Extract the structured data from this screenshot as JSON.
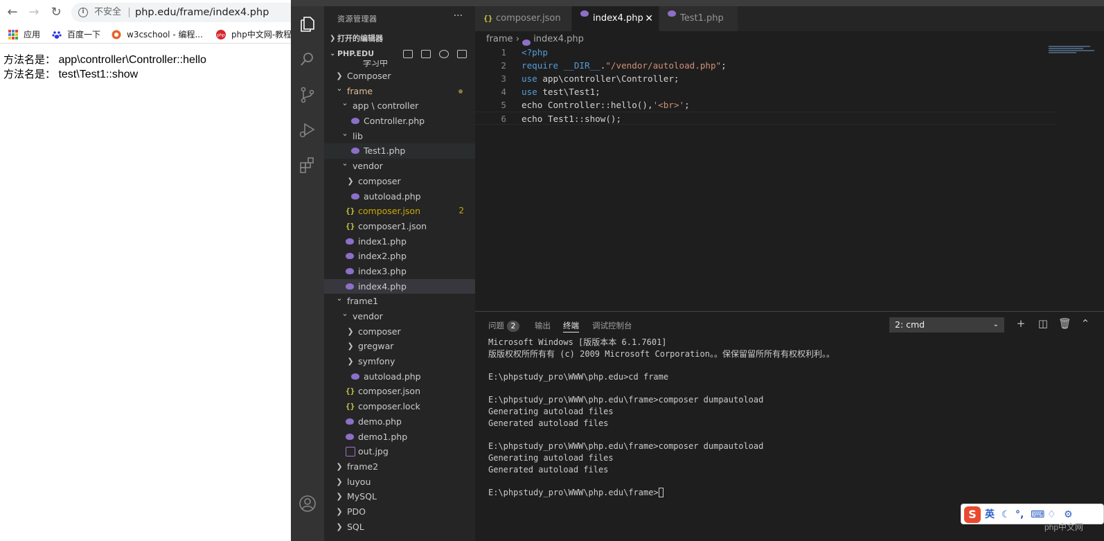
{
  "browser": {
    "url_warning": "不安全",
    "url": "php.edu/frame/index4.php",
    "bookmarks": [
      {
        "label": "应用",
        "icon": "apps-icon"
      },
      {
        "label": "百度一下",
        "icon": "baidu-paw-icon"
      },
      {
        "label": "w3cschool - 编程...",
        "icon": "w3cschool-icon"
      },
      {
        "label": "php中文网-教程",
        "icon": "php-cn-icon"
      }
    ],
    "output": [
      {
        "label": "方法名是：",
        "value": " app\\controller\\Controller::hello"
      },
      {
        "label": "方法名是：",
        "value": " test\\Test1::show"
      }
    ]
  },
  "explorer": {
    "title": "资源管理器",
    "open_editors_label": "打开的编辑器",
    "workspace_label": "PHP.EDU",
    "partial_top_label": "学习中",
    "items": [
      {
        "name": "Composer",
        "type": "folder",
        "depth": 0,
        "expanded": false
      },
      {
        "name": "frame",
        "type": "folder",
        "depth": 0,
        "expanded": true,
        "modified": true
      },
      {
        "name": "app \\ controller",
        "type": "folder",
        "depth": 1,
        "expanded": true
      },
      {
        "name": "Controller.php",
        "type": "php",
        "depth": 2
      },
      {
        "name": "lib",
        "type": "folder",
        "depth": 1,
        "expanded": true
      },
      {
        "name": "Test1.php",
        "type": "php",
        "depth": 2,
        "hover": true
      },
      {
        "name": "vendor",
        "type": "folder",
        "depth": 1,
        "expanded": true
      },
      {
        "name": "composer",
        "type": "folder",
        "depth": 2,
        "expanded": false
      },
      {
        "name": "autoload.php",
        "type": "php",
        "depth": 2
      },
      {
        "name": "composer.json",
        "type": "json",
        "depth": 1,
        "warning": true,
        "badge": "2"
      },
      {
        "name": "composer1.json",
        "type": "json",
        "depth": 1
      },
      {
        "name": "index1.php",
        "type": "php",
        "depth": 1
      },
      {
        "name": "index2.php",
        "type": "php",
        "depth": 1
      },
      {
        "name": "index3.php",
        "type": "php",
        "depth": 1
      },
      {
        "name": "index4.php",
        "type": "php",
        "depth": 1,
        "selected": true
      },
      {
        "name": "frame1",
        "type": "folder",
        "depth": 0,
        "expanded": true
      },
      {
        "name": "vendor",
        "type": "folder",
        "depth": 1,
        "expanded": true
      },
      {
        "name": "composer",
        "type": "folder",
        "depth": 2,
        "expanded": false
      },
      {
        "name": "gregwar",
        "type": "folder",
        "depth": 2,
        "expanded": false
      },
      {
        "name": "symfony",
        "type": "folder",
        "depth": 2,
        "expanded": false
      },
      {
        "name": "autoload.php",
        "type": "php",
        "depth": 2
      },
      {
        "name": "composer.json",
        "type": "json",
        "depth": 1
      },
      {
        "name": "composer.lock",
        "type": "json",
        "depth": 1
      },
      {
        "name": "demo.php",
        "type": "php",
        "depth": 1
      },
      {
        "name": "demo1.php",
        "type": "php",
        "depth": 1
      },
      {
        "name": "out.jpg",
        "type": "image",
        "depth": 1
      },
      {
        "name": "frame2",
        "type": "folder",
        "depth": 0,
        "expanded": false
      },
      {
        "name": "luyou",
        "type": "folder",
        "depth": 0,
        "expanded": false
      },
      {
        "name": "MySQL",
        "type": "folder",
        "depth": 0,
        "expanded": false
      },
      {
        "name": "PDO",
        "type": "folder",
        "depth": 0,
        "expanded": false
      },
      {
        "name": "SQL",
        "type": "folder",
        "depth": 0,
        "expanded": false
      }
    ]
  },
  "editor": {
    "tabs": [
      {
        "label": "composer.json",
        "type": "json",
        "active": false
      },
      {
        "label": "index4.php",
        "type": "php",
        "active": true
      },
      {
        "label": "Test1.php",
        "type": "php",
        "active": false
      }
    ],
    "breadcrumb": {
      "folder": "frame",
      "file": "index4.php"
    },
    "code": [
      [
        {
          "t": "<?php",
          "c": "kw"
        }
      ],
      [
        {
          "t": "require ",
          "c": "kw"
        },
        {
          "t": "__DIR__",
          "c": "kw"
        },
        {
          "t": "."
        },
        {
          "t": "\"/vendor/autoload.php\"",
          "c": "str"
        },
        {
          "t": ";"
        }
      ],
      [
        {
          "t": "use ",
          "c": "kw"
        },
        {
          "t": "app\\controller\\Controller;"
        }
      ],
      [
        {
          "t": "use ",
          "c": "kw"
        },
        {
          "t": "test\\Test1;"
        }
      ],
      [
        {
          "t": "echo Controller::hello(),"
        },
        {
          "t": "'<br>'",
          "c": "str"
        },
        {
          "t": ";"
        }
      ],
      [
        {
          "t": "echo Test1::show();"
        }
      ]
    ]
  },
  "panel": {
    "tabs": [
      {
        "label": "问题",
        "count": "2"
      },
      {
        "label": "输出"
      },
      {
        "label": "终端",
        "active": true
      },
      {
        "label": "调试控制台"
      }
    ],
    "terminal_select": "2: cmd",
    "terminal_lines": [
      "Microsoft Windows [版版本本 6.1.7601]",
      "版版权权所所有有 (c) 2009 Microsoft Corporation。。保保留留所所有有权权利利。。",
      "",
      "E:\\phpstudy_pro\\WWW\\php.edu>cd frame",
      "",
      "E:\\phpstudy_pro\\WWW\\php.edu\\frame>composer dumpautoload",
      "Generating autoload files",
      "Generated autoload files",
      "",
      "E:\\phpstudy_pro\\WWW\\php.edu\\frame>composer dumpautoload",
      "Generating autoload files",
      "Generated autoload files",
      ""
    ],
    "prompt": "E:\\phpstudy_pro\\WWW\\php.edu\\frame>"
  },
  "ime": {
    "lang": "英"
  },
  "watermark": "php中文网"
}
